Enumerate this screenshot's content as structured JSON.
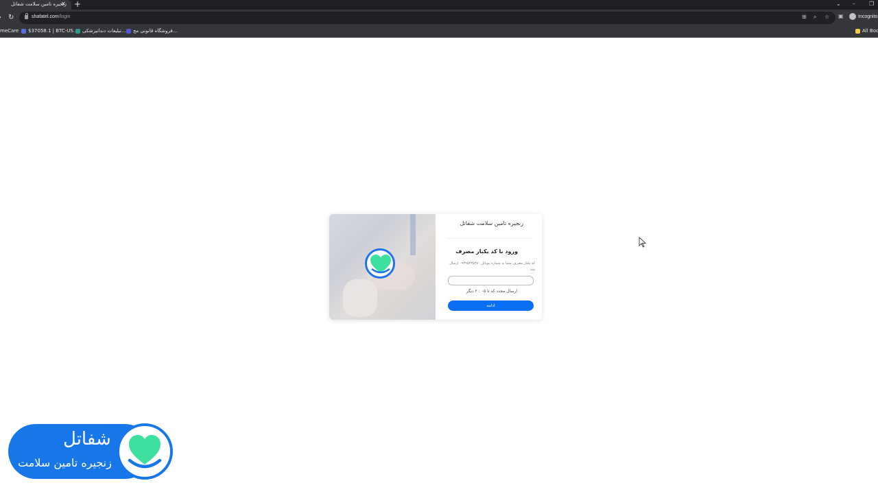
{
  "browser": {
    "tab_title": "زنجیره تامین سلامت شفاتل",
    "url_host": "shafatel.com",
    "url_path": "/login",
    "profile_label": "Incognito",
    "bookmarks": [
      {
        "label": "meCare",
        "icon": "bookmark-icon"
      },
      {
        "label": "$37058.1 | BTC-US...",
        "icon": "crypto-icon"
      },
      {
        "label": "تبلیغات دندانپزشکی...",
        "icon": "ad-icon"
      },
      {
        "label": "فروشگاه قانونی مج...",
        "icon": "shop-icon"
      }
    ],
    "all_bookmarks_label": "All Boo"
  },
  "login": {
    "brand_title": "زنجیره تامین سلامت شفاتل",
    "heading": "ورود با کد یکبار مصرف",
    "description": "کد یکبار مصرف شما به شماره موبایل ۰۹۳۹۵۴۲۵۲۷۰ ارسال شد",
    "code_value": "",
    "resend_text": "ارسال مجدد کد تا ۰۵ : ۲ دیگر",
    "continue_label": "ادامه"
  },
  "watermark": {
    "name": "شفاتل",
    "tagline": "زنجیره تامین سلامت"
  },
  "colors": {
    "accent": "#0a6ff5",
    "heart": "#3ee0a0",
    "brand_blue": "#1877e8"
  }
}
